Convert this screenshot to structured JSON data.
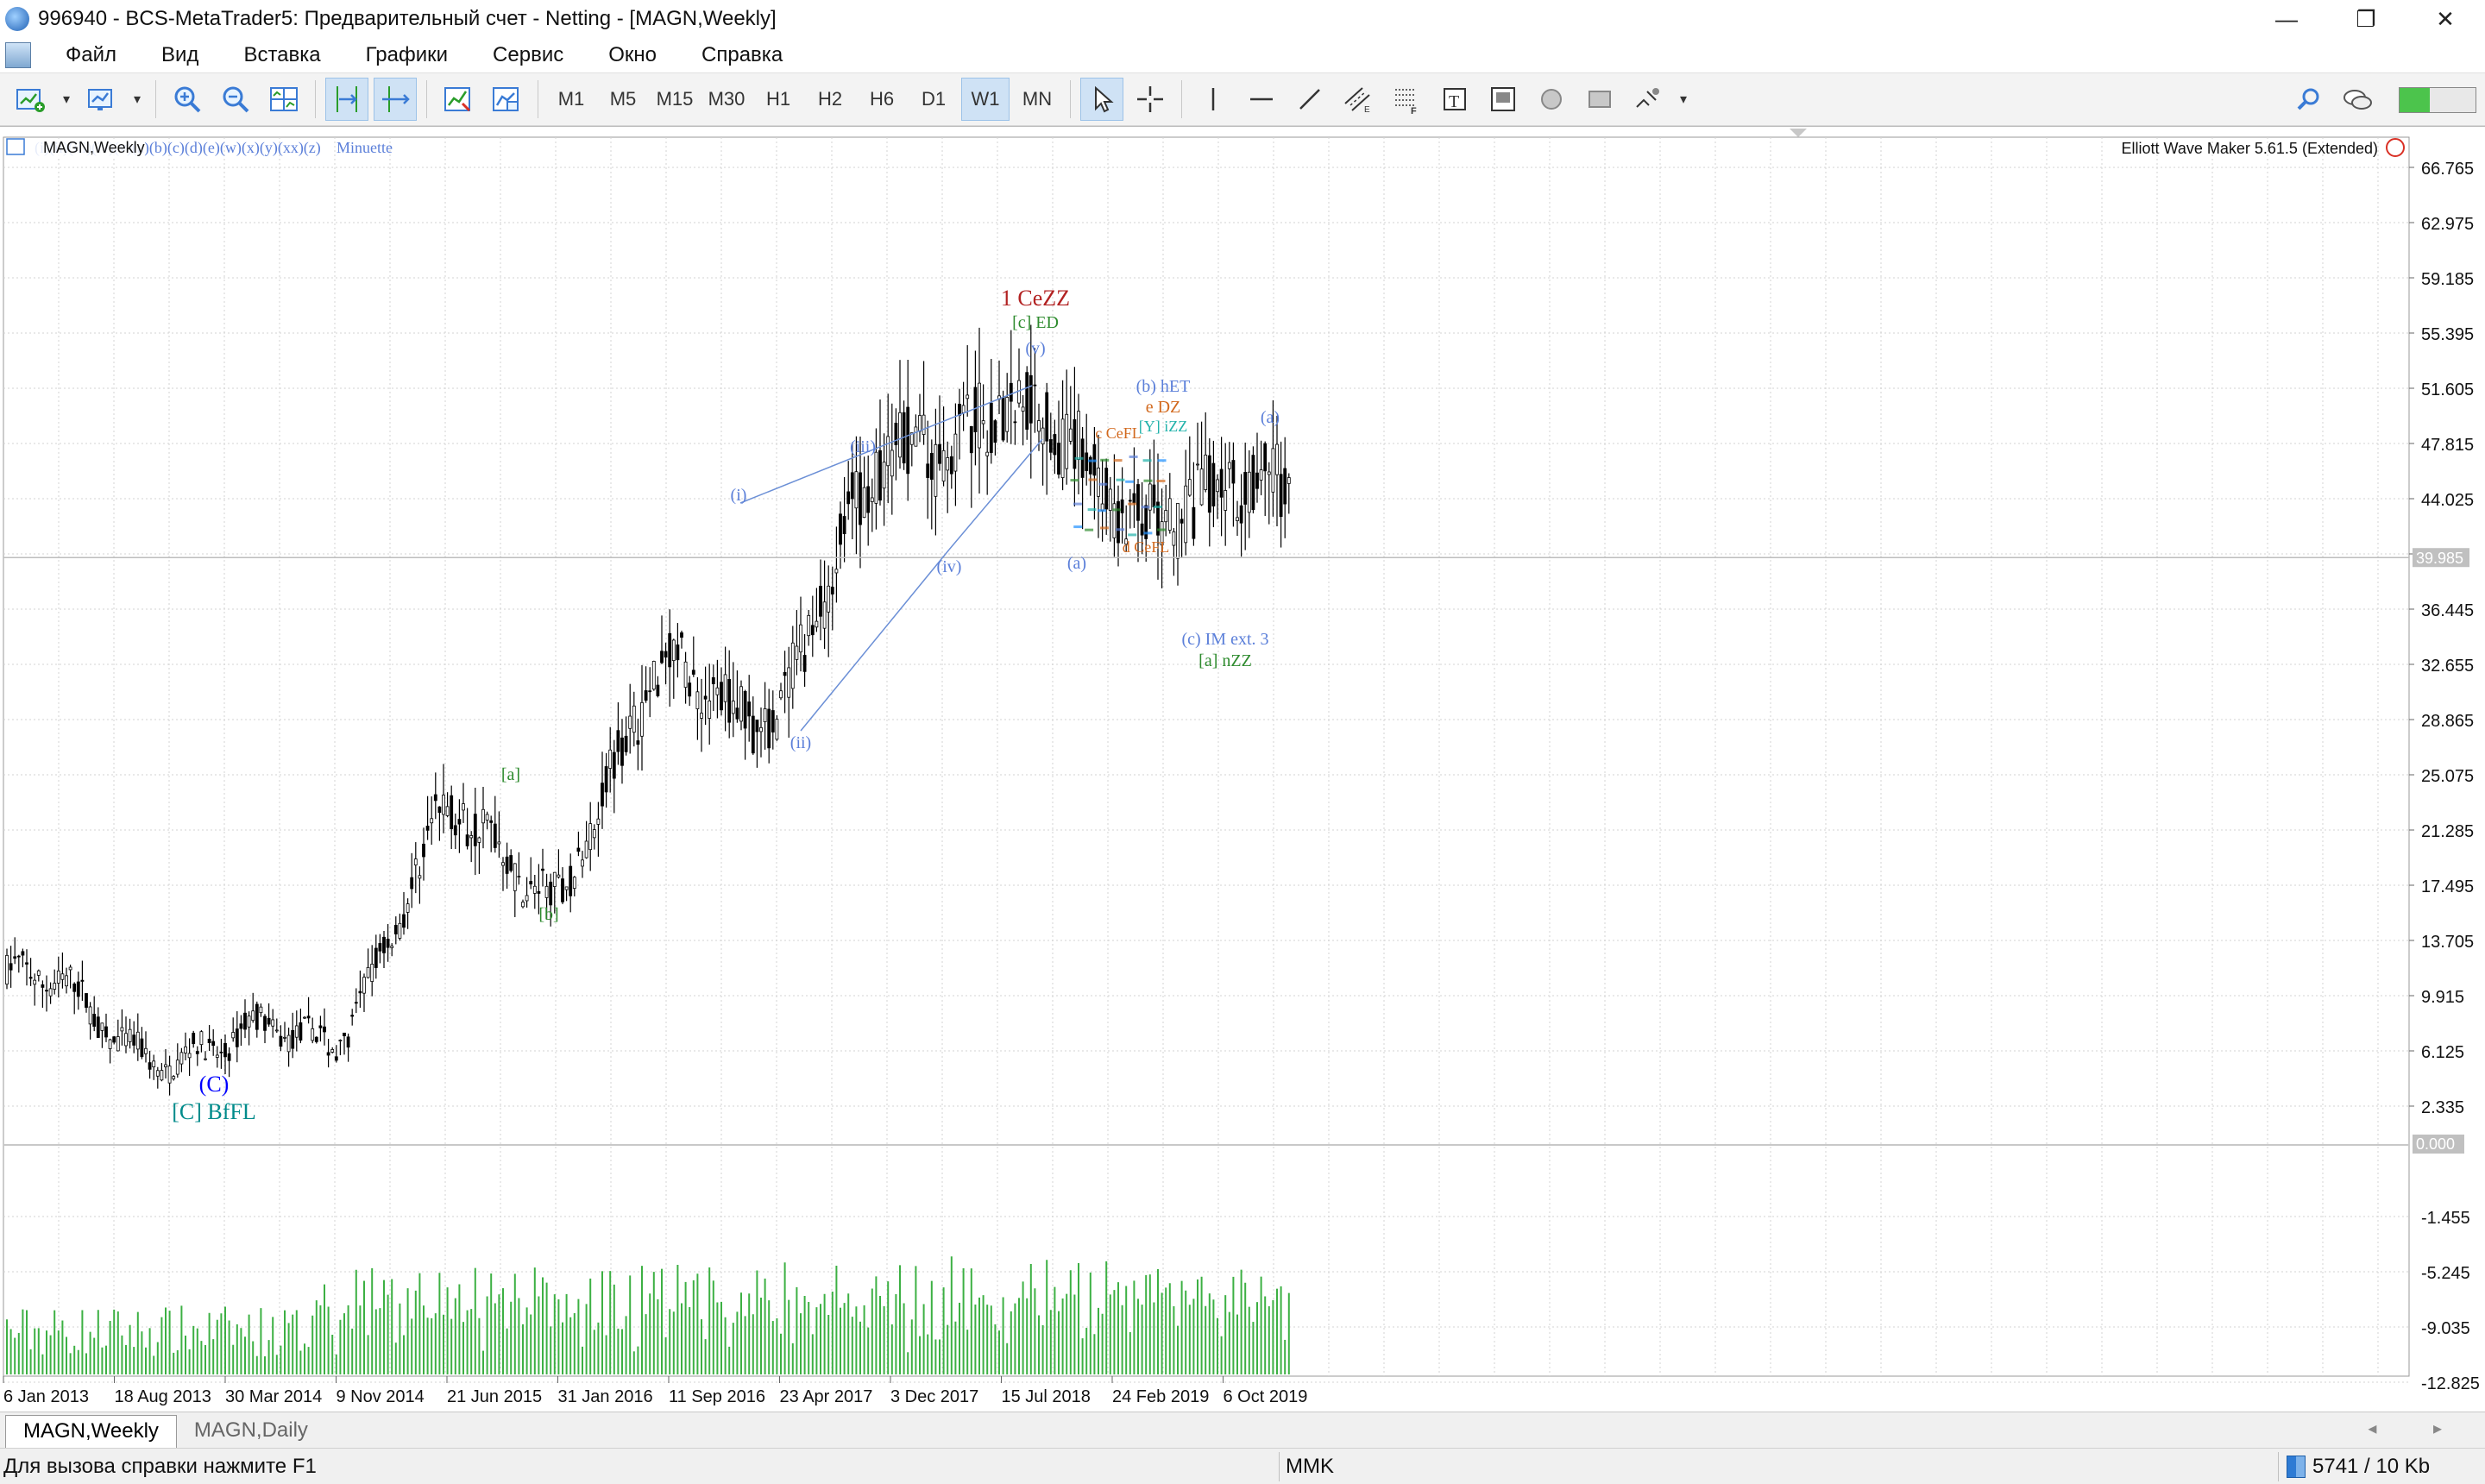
{
  "window": {
    "title": "996940 - BCS-MetaTrader5: Предварительный счет - Netting - [MAGN,Weekly]",
    "controls": {
      "minimize": "—",
      "restore": "❐",
      "close": "✕"
    }
  },
  "menu": {
    "items": [
      "Файл",
      "Вид",
      "Вставка",
      "Графики",
      "Сервис",
      "Окно",
      "Справка"
    ],
    "mdi_controls": {
      "minimize": "-",
      "restore": "▫",
      "close": "×"
    }
  },
  "toolbar": {
    "timeframes": [
      "M1",
      "M5",
      "M15",
      "M30",
      "H1",
      "H2",
      "H6",
      "D1",
      "W1",
      "MN"
    ],
    "active_timeframe": "W1"
  },
  "chart": {
    "symbol_label": "MAGN,Weekly",
    "wave_degrees_label": "(i)(ii)(iii)(iv)(v)(a)(b)(c)(d)(e)(w)(x)(y)(xx)(z)",
    "degree_name": "Minuette",
    "indicator_label": "Elliott Wave Maker 5.61.5 (Extended)",
    "current_price": "39.985",
    "volume_zero_label": "0.000"
  },
  "chart_data": {
    "type": "candlestick",
    "y_axis_ticks": [
      66.765,
      62.975,
      59.185,
      55.395,
      51.605,
      47.815,
      44.025,
      40.235,
      36.445,
      32.655,
      28.865,
      25.075,
      21.285,
      17.495,
      13.705,
      9.915,
      6.125,
      2.335
    ],
    "y_axis_tick_labels": [
      "66.765",
      "62.975",
      "59.185",
      "55.395",
      "51.605",
      "47.815",
      "44.025",
      "",
      "36.445",
      "32.655",
      "28.865",
      "25.075",
      "21.285",
      "17.495",
      "13.705",
      "9.915",
      "6.125",
      "2.335"
    ],
    "lower_axis_tick_labels": [
      "-1.455",
      "-5.245",
      "-9.035",
      "-12.825"
    ],
    "x_axis_labels": [
      "6 Jan 2013",
      "18 Aug 2013",
      "30 Mar 2014",
      "9 Nov 2014",
      "21 Jun 2015",
      "31 Jan 2016",
      "11 Sep 2016",
      "23 Apr 2017",
      "3 Dec 2017",
      "15 Jul 2018",
      "24 Feb 2019",
      "6 Oct 2019"
    ],
    "price_path_key_points": [
      {
        "x": "6 Jan 2013",
        "y": 11.0
      },
      {
        "x": "18 Aug 2013",
        "y": 7.8
      },
      {
        "x": "30 Mar 2014",
        "y": 5.5
      },
      {
        "x": "9 Nov 2014",
        "y": 8.0
      },
      {
        "x": "21 Jun 2015",
        "y": 21.5
      },
      {
        "x": "31 Jan 2016",
        "y": 18.0
      },
      {
        "x": "11 Sep 2016",
        "y": 32.0
      },
      {
        "x": "23 Apr 2017",
        "y": 30.0
      },
      {
        "x": "3 Dec 2017",
        "y": 47.0
      },
      {
        "x": "15 Jul 2018",
        "y": 51.0
      },
      {
        "x": "24 Feb 2019",
        "y": 44.0
      },
      {
        "x": "6 Oct 2019",
        "y": 44.0
      }
    ],
    "wave_labels": [
      {
        "text": "(C)",
        "color": "#0000ff"
      },
      {
        "text": "[C] BfFL",
        "color": "#008b8b"
      },
      {
        "text": "[a]",
        "color": "#2e8b2e"
      },
      {
        "text": "[b]",
        "color": "#2e8b2e"
      },
      {
        "text": "(i)",
        "color": "#5b7fd9"
      },
      {
        "text": "(ii)",
        "color": "#5b7fd9"
      },
      {
        "text": "(iii)",
        "color": "#5b7fd9"
      },
      {
        "text": "(iv)",
        "color": "#5b7fd9"
      },
      {
        "text": "(v)",
        "color": "#5b7fd9"
      },
      {
        "text": "1 CeZZ",
        "color": "#b22222"
      },
      {
        "text": "[c] ED",
        "color": "#2e8b2e"
      },
      {
        "text": "(a)",
        "color": "#5b7fd9"
      },
      {
        "text": "(b) hET",
        "color": "#5b7fd9"
      },
      {
        "text": "e DZ",
        "color": "#d2691e"
      },
      {
        "text": "[Y] iZZ",
        "color": "#20b2aa"
      },
      {
        "text": "c CeFL",
        "color": "#d2691e"
      },
      {
        "text": "d CeFL",
        "color": "#d2691e"
      },
      {
        "text": "(c) IM ext. 3",
        "color": "#5b7fd9"
      },
      {
        "text": "[a] nZZ",
        "color": "#2e8b2e"
      },
      {
        "text": "(a)",
        "color": "#5b7fd9"
      }
    ]
  },
  "tabs": {
    "items": [
      "MAGN,Weekly",
      "MAGN,Daily"
    ],
    "active": "MAGN,Weekly",
    "scroll": "◂ ▸"
  },
  "status": {
    "help": "Для вызова справки нажмите F1",
    "symbol": "MMK",
    "connection": "5741 / 10 Kb"
  },
  "colors": {
    "candle": "#000000",
    "volume": "#3cb043",
    "grid": "#d3d3d3",
    "wedge_line": "#6b8fd6",
    "current_price_bg": "#c0c0c0"
  }
}
